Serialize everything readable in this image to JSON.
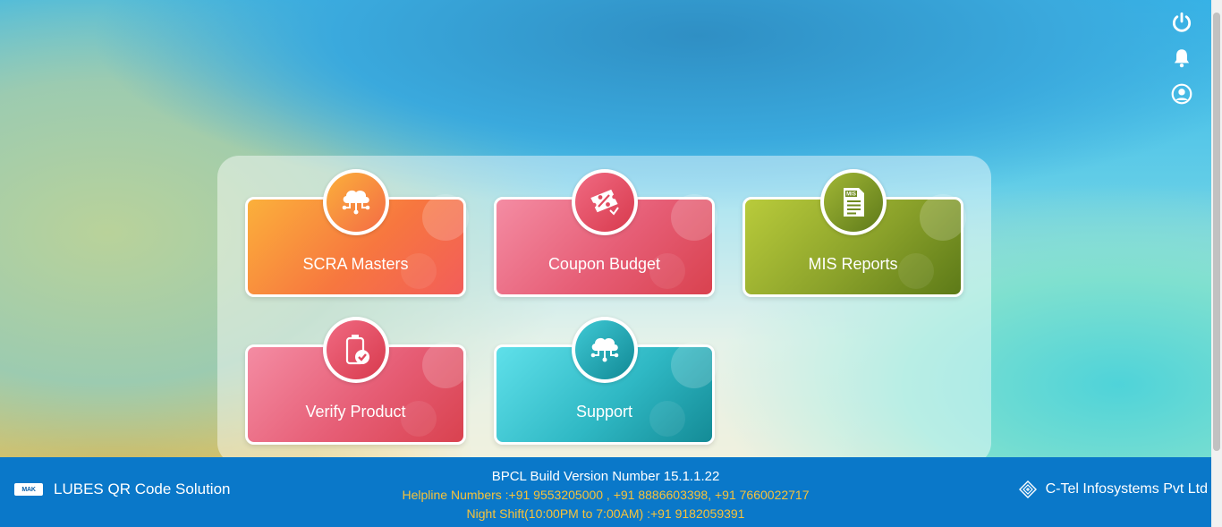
{
  "tiles": [
    {
      "id": "scra",
      "label": "SCRA Masters",
      "icon": "cloud-network-icon"
    },
    {
      "id": "coupon",
      "label": "Coupon Budget",
      "icon": "coupon-percent-icon"
    },
    {
      "id": "mis",
      "label": "MIS Reports",
      "icon": "mis-document-icon",
      "icon_text": "MIS"
    },
    {
      "id": "verify",
      "label": "Verify Product",
      "icon": "verified-bottle-icon"
    },
    {
      "id": "support",
      "label": "Support",
      "icon": "cloud-network-icon"
    }
  ],
  "top_icons": [
    "power-icon",
    "bell-icon",
    "user-icon"
  ],
  "footer": {
    "brand_logo_text": "MAK",
    "app_name": "LUBES QR Code Solution",
    "build_version": "BPCL Build Version Number 15.1.1.22",
    "helpline": "Helpline Numbers :+91 9553205000 , +91 8886603398, +91 7660022717",
    "night_shift": "Night Shift(10:00PM to 7:00AM) :+91 9182059391",
    "company": "C-Tel Infosystems Pvt Ltd"
  },
  "colors": {
    "footer_bg": "#0a78c9",
    "helpline_text": "#f7c23a"
  }
}
